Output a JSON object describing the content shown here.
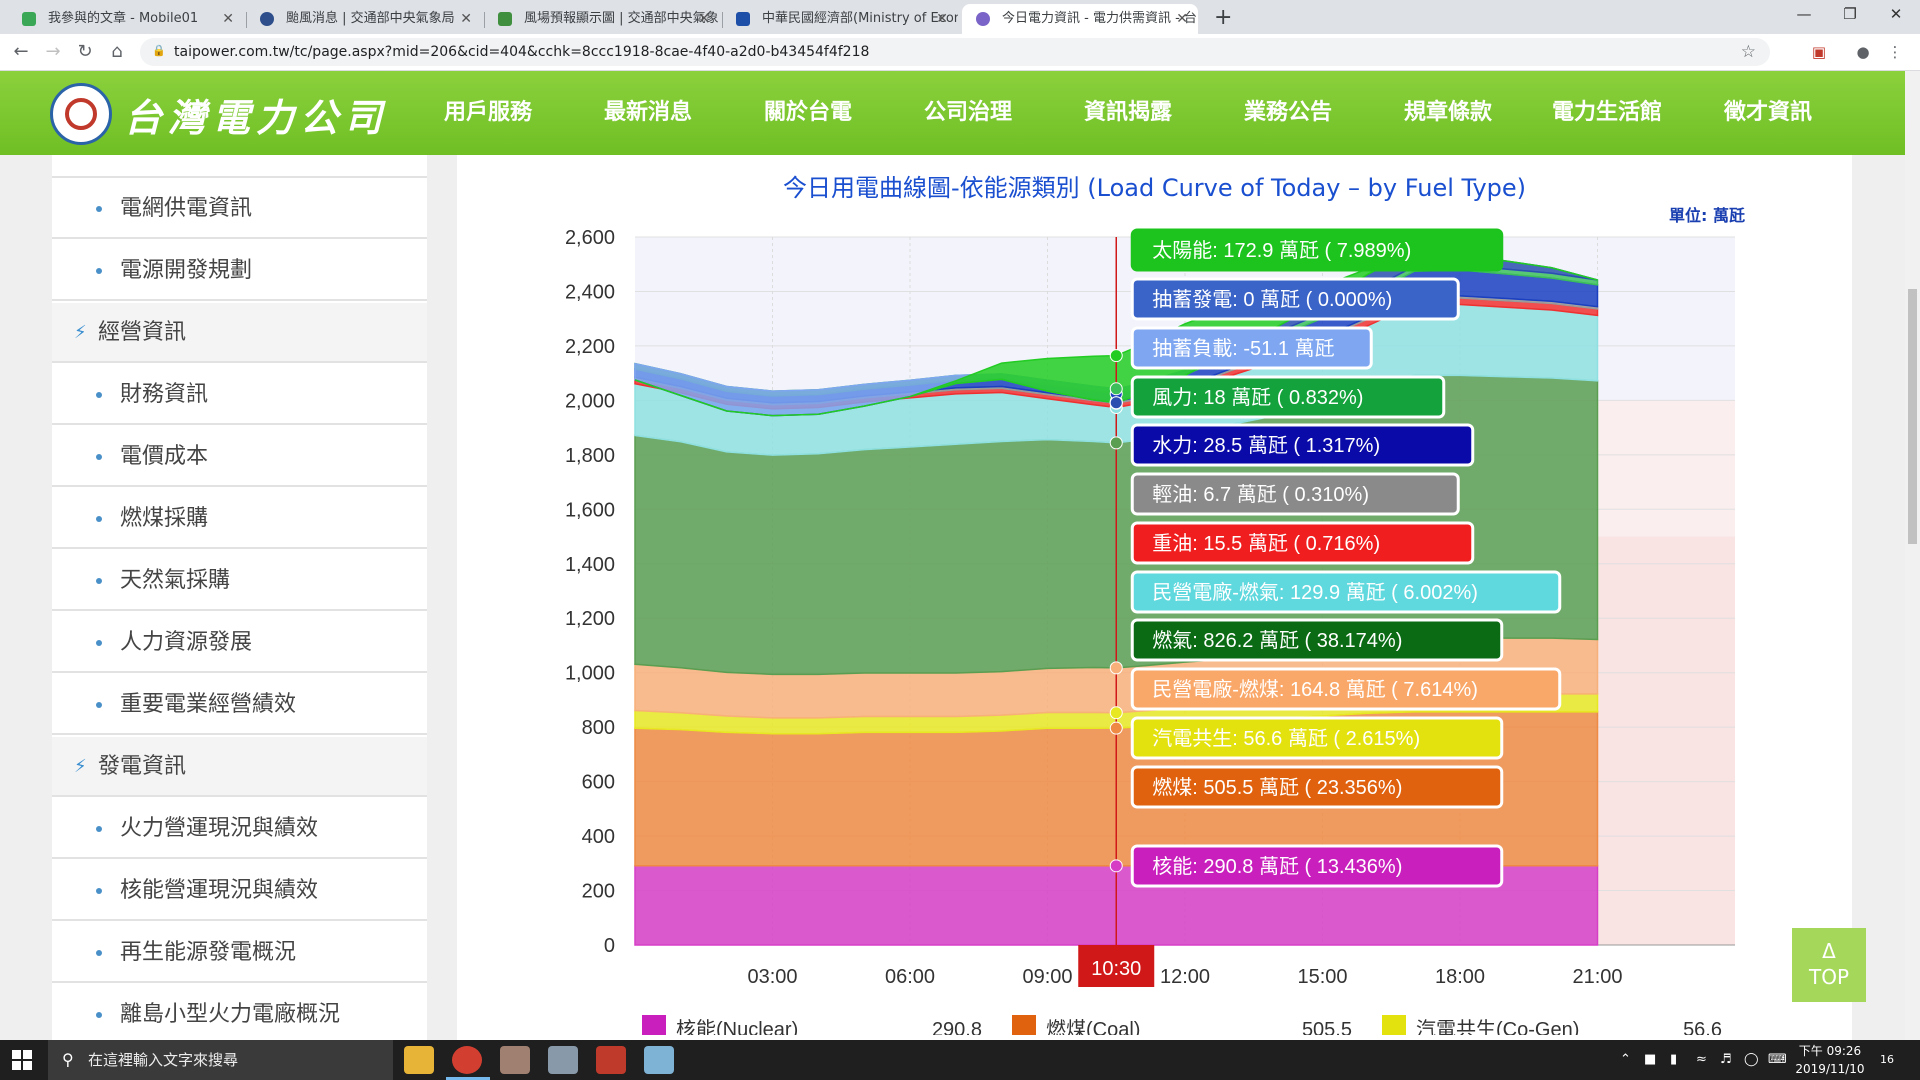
{
  "browser": {
    "tabs": [
      {
        "title": "我參與的文章 - Mobile01",
        "color": "#3aa757"
      },
      {
        "title": "颱風消息 | 交通部中央氣象局",
        "color": "#2d4e8a"
      },
      {
        "title": "風場預報顯示圖 | 交通部中央氣象",
        "color": "#3f8f3f"
      },
      {
        "title": "中華民國經濟部(Ministry of Econ",
        "color": "#1e4fa8"
      },
      {
        "title": "今日電力資訊 - 電力供需資訊 - 台",
        "color": "#7a64c8"
      }
    ],
    "close_glyph": "✕",
    "new_tab_glyph": "+",
    "url": "taipower.com.tw/tc/page.aspx?mid=206&cid=404&cchk=8ccc1918-8cae-4f40-a2d0-b43454f4f218"
  },
  "site": {
    "logo_text": "台灣電力公司",
    "nav": [
      "用戶服務",
      "最新消息",
      "關於台電",
      "公司治理",
      "資訊揭露",
      "業務公告",
      "規章條款",
      "電力生活館",
      "徵才資訊"
    ]
  },
  "sidebar": {
    "items": [
      {
        "label": "電網供電資訊",
        "type": "sub"
      },
      {
        "label": "電源開發規劃",
        "type": "sub"
      },
      {
        "label": "經營資訊",
        "type": "cat"
      },
      {
        "label": "財務資訊",
        "type": "sub"
      },
      {
        "label": "電價成本",
        "type": "sub"
      },
      {
        "label": "燃煤採購",
        "type": "sub"
      },
      {
        "label": "天然氣採購",
        "type": "sub"
      },
      {
        "label": "人力資源發展",
        "type": "sub"
      },
      {
        "label": "重要電業經營績效",
        "type": "sub"
      },
      {
        "label": "發電資訊",
        "type": "cat"
      },
      {
        "label": "火力營運現況與績效",
        "type": "sub"
      },
      {
        "label": "核能營運現況與績效",
        "type": "sub"
      },
      {
        "label": "再生能源發電概況",
        "type": "sub"
      },
      {
        "label": "離島小型火力電廠概況",
        "type": "sub"
      }
    ]
  },
  "chart": {
    "title": "今日用電曲線圖-依能源類別 (Load Curve of Today – by Fuel Type)",
    "unit": "單位: 萬瓩",
    "cursor_label": "10:30"
  },
  "chart_data": {
    "type": "area",
    "stacked": true,
    "x": [
      "00:00",
      "01:00",
      "02:00",
      "03:00",
      "04:00",
      "05:00",
      "06:00",
      "07:00",
      "08:00",
      "09:00",
      "10:00",
      "10:30",
      "11:00",
      "12:00",
      "13:00",
      "14:00",
      "15:00",
      "16:00",
      "17:00",
      "18:00",
      "19:00",
      "20:00",
      "21:00"
    ],
    "x_ticks": [
      "03:00",
      "06:00",
      "09:00",
      "12:00",
      "15:00",
      "18:00",
      "21:00"
    ],
    "ylim": [
      0,
      2600
    ],
    "y_ticks": [
      "0",
      "200",
      "400",
      "600",
      "800",
      "1,000",
      "1,200",
      "1,400",
      "1,600",
      "1,800",
      "2,000",
      "2,200",
      "2,400",
      "2,600"
    ],
    "series": [
      {
        "name": "核能",
        "color": "#d63ec6",
        "values": [
          291,
          291,
          291,
          291,
          291,
          291,
          291,
          291,
          291,
          291,
          291,
          290.8,
          291,
          291,
          291,
          291,
          291,
          291,
          291,
          291,
          291,
          291,
          291
        ]
      },
      {
        "name": "燃煤",
        "color": "#ee8a43",
        "values": [
          505,
          500,
          490,
          485,
          485,
          490,
          490,
          490,
          495,
          505,
          505,
          505.5,
          510,
          520,
          530,
          540,
          550,
          560,
          565,
          565,
          565,
          565,
          565
        ]
      },
      {
        "name": "汽電共生",
        "color": "#e8e822",
        "values": [
          65,
          62,
          60,
          58,
          58,
          58,
          58,
          58,
          58,
          58,
          58,
          56.6,
          58,
          60,
          60,
          62,
          62,
          64,
          66,
          66,
          66,
          66,
          66
        ]
      },
      {
        "name": "民營電廠-燃煤",
        "color": "#f8b07a",
        "values": [
          170,
          165,
          160,
          160,
          160,
          160,
          160,
          160,
          160,
          162,
          165,
          164.8,
          165,
          168,
          170,
          172,
          180,
          190,
          200,
          210,
          205,
          205,
          200
        ]
      },
      {
        "name": "燃氣",
        "color": "#5a9e52",
        "values": [
          840,
          830,
          810,
          805,
          810,
          820,
          830,
          840,
          845,
          840,
          830,
          826.2,
          830,
          840,
          860,
          880,
          900,
          930,
          970,
          960,
          960,
          955,
          950
        ]
      },
      {
        "name": "民營電廠-燃氣",
        "color": "#8fe0e0",
        "values": [
          190,
          180,
          175,
          170,
          170,
          175,
          180,
          185,
          180,
          150,
          135,
          129.9,
          135,
          150,
          180,
          200,
          220,
          240,
          260,
          260,
          255,
          250,
          240
        ]
      },
      {
        "name": "重油",
        "color": "#f03030",
        "values": [
          17,
          16,
          15,
          15,
          15,
          15,
          15,
          15,
          15,
          15,
          15,
          15.5,
          16,
          17,
          18,
          20,
          22,
          24,
          24,
          24,
          24,
          24,
          24
        ]
      },
      {
        "name": "輕油",
        "color": "#9a9a9a",
        "values": [
          7,
          7,
          7,
          7,
          7,
          7,
          7,
          7,
          7,
          7,
          7,
          6.7,
          7,
          7,
          7,
          7,
          7,
          7,
          8,
          8,
          8,
          8,
          8
        ]
      },
      {
        "name": "水力",
        "color": "#1a3fc0",
        "values": [
          30,
          28,
          25,
          25,
          25,
          25,
          25,
          28,
          28,
          28,
          28,
          28.5,
          30,
          40,
          50,
          60,
          70,
          80,
          90,
          95,
          90,
          85,
          80
        ]
      },
      {
        "name": "風力",
        "color": "#3cbf5a",
        "values": [
          20,
          19,
          18,
          18,
          18,
          18,
          18,
          18,
          18,
          18,
          18,
          18,
          18,
          18,
          18,
          18,
          18,
          18,
          18,
          18,
          18,
          18,
          18
        ]
      },
      {
        "name": "抽蓄負載",
        "color": "#7fa6f0",
        "values": [
          -60,
          -80,
          -90,
          -90,
          -90,
          -80,
          -60,
          -30,
          -20,
          -40,
          -50,
          -51.1,
          -40,
          -20,
          0,
          0,
          0,
          0,
          0,
          0,
          0,
          0,
          0
        ]
      },
      {
        "name": "抽蓄發電",
        "color": "#2a4fb0",
        "values": [
          0,
          0,
          0,
          0,
          0,
          0,
          0,
          0,
          0,
          0,
          0,
          0,
          0,
          0,
          0,
          20,
          40,
          60,
          60,
          40,
          30,
          20,
          0
        ]
      },
      {
        "name": "太陽能",
        "color": "#22cc22",
        "values": [
          0,
          0,
          0,
          0,
          0,
          0,
          0,
          10,
          60,
          120,
          160,
          172.9,
          180,
          190,
          160,
          110,
          60,
          20,
          0,
          0,
          0,
          0,
          0
        ]
      }
    ],
    "tooltip": [
      {
        "text": "太陽能: 172.9 萬瓩 ( 7.989%)",
        "bg": "#1ec41e",
        "border": "#1ec41e",
        "color": "#ffffff"
      },
      {
        "text": "抽蓄發電: 0 萬瓩 ( 0.000%)",
        "bg": "#3b64c8",
        "border": "#ffffff",
        "color": "#ffffff"
      },
      {
        "text": "抽蓄負載: -51.1 萬瓩",
        "bg": "#7fa6f0",
        "border": "#ffffff",
        "color": "#ffffff"
      },
      {
        "text": "風力: 18 萬瓩 ( 0.832%)",
        "bg": "#14a23c",
        "border": "#ffffff",
        "color": "#ffffff"
      },
      {
        "text": "水力: 28.5 萬瓩 ( 1.317%)",
        "bg": "#0a0aa8",
        "border": "#ffffff",
        "color": "#ffffff"
      },
      {
        "text": "輕油: 6.7 萬瓩 ( 0.310%)",
        "bg": "#8a8a8a",
        "border": "#ffffff",
        "color": "#ffffff"
      },
      {
        "text": "重油: 15.5 萬瓩 ( 0.716%)",
        "bg": "#f01e1e",
        "border": "#ffffff",
        "color": "#ffffff"
      },
      {
        "text": "民營電廠-燃氣: 129.9 萬瓩 ( 6.002%)",
        "bg": "#5fd8de",
        "border": "#ffffff",
        "color": "#ffffff"
      },
      {
        "text": "燃氣: 826.2 萬瓩 ( 38.174%)",
        "bg": "#0b6b14",
        "border": "#ffffff",
        "color": "#ffffff"
      },
      {
        "text": "民營電廠-燃煤: 164.8 萬瓩 ( 7.614%)",
        "bg": "#f9a86a",
        "border": "#ffffff",
        "color": "#ffffff"
      },
      {
        "text": "汽電共生: 56.6 萬瓩 ( 2.615%)",
        "bg": "#e4e20e",
        "border": "#ffffff",
        "color": "#ffffff"
      },
      {
        "text": "燃煤: 505.5 萬瓩 ( 23.356%)",
        "bg": "#e0620e",
        "border": "#ffffff",
        "color": "#ffffff"
      },
      {
        "text": "核能: 290.8 萬瓩 ( 13.436%)",
        "bg": "#c81fbd",
        "border": "#ffffff",
        "color": "#ffffff"
      }
    ],
    "legend": [
      {
        "name": "核能(Nuclear)",
        "value": "290.8",
        "color": "#c81fbd"
      },
      {
        "name": "燃煤(Coal)",
        "value": "505.5",
        "color": "#e0620e"
      },
      {
        "name": "汽電共生(Co-Gen)",
        "value": "56.6",
        "color": "#e4e20e"
      }
    ]
  },
  "top_button": {
    "arrow": "Δ",
    "label": "TOP"
  },
  "taskbar": {
    "search_placeholder": "在這裡輸入文字來搜尋",
    "time": "下午 09:26",
    "date": "2019/11/10",
    "notif_count": "16"
  }
}
